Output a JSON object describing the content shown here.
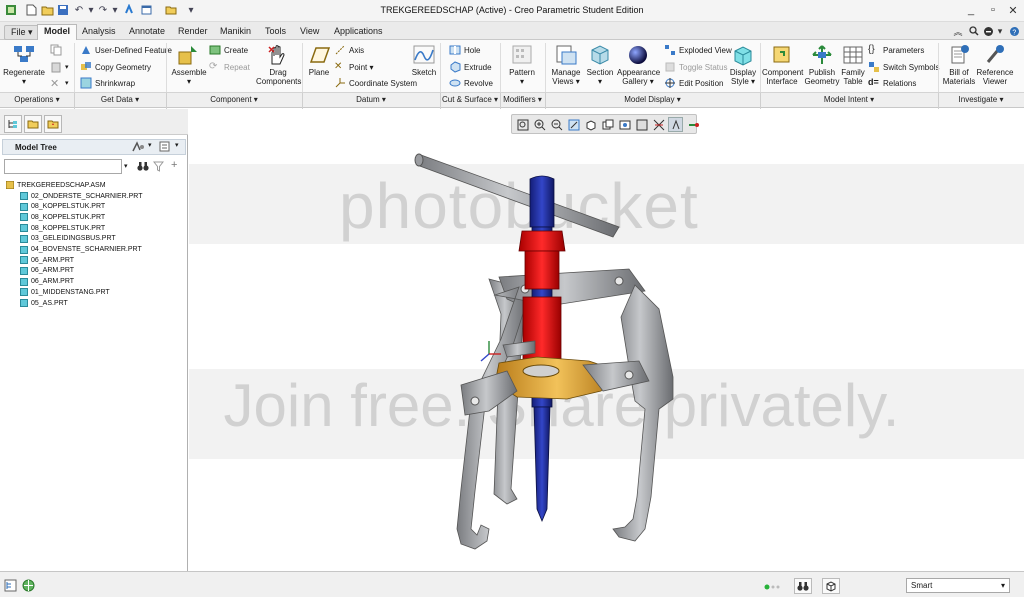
{
  "window": {
    "title": "TREKGEREEDSCHAP (Active) - Creo Parametric Student Edition"
  },
  "colors": {
    "accent": "#2f6fb8",
    "ribbon_bg": "#fafafa",
    "tree_part_icon": "#5fc8d9",
    "assembly_icon": "#e6c04a",
    "red_part": "#e01a1a",
    "blue_part": "#1f2fa8",
    "gold_part": "#e8a93a",
    "grey_part": "#a8aaae"
  },
  "menu": {
    "tabs": [
      "File",
      "Model",
      "Analysis",
      "Annotate",
      "Render",
      "Manikin",
      "Tools",
      "View",
      "Applications"
    ],
    "active": "Model"
  },
  "ribbon": {
    "regenerate": "Regenerate",
    "user_defined_feature": "User-Defined Feature",
    "copy_geometry": "Copy Geometry",
    "shrinkwrap": "Shrinkwrap",
    "assemble": "Assemble",
    "create": "Create",
    "repeat": "Repeat",
    "drag_components": "Drag Components",
    "plane": "Plane",
    "axis": "Axis",
    "point": "Point",
    "coordinate_system": "Coordinate System",
    "sketch": "Sketch",
    "hole": "Hole",
    "extrude": "Extrude",
    "revolve": "Revolve",
    "pattern": "Pattern",
    "manage_views": "Manage Views",
    "section": "Section",
    "appearance_gallery": "Appearance Gallery",
    "exploded_view": "Exploded View",
    "toggle_status": "Toggle Status",
    "edit_position": "Edit Position",
    "display_style": "Display Style",
    "component_interface": "Component Interface",
    "publish_geometry": "Publish Geometry",
    "family_table": "Family Table",
    "parameters": "Parameters",
    "switch_symbols": "Switch Symbols",
    "relations": "Relations",
    "bill_of_materials": "Bill of Materials",
    "reference_viewer": "Reference Viewer"
  },
  "groups": [
    "Operations",
    "Get Data",
    "Component",
    "Datum",
    "Cut & Surface",
    "Modifiers",
    "Model Display",
    "Model Intent",
    "Investigate"
  ],
  "model_tree": {
    "title": "Model Tree",
    "search_placeholder": "",
    "root": "TREKGEREEDSCHAP.ASM",
    "items": [
      "02_ONDERSTE_SCHARNIER.PRT",
      "08_KOPPELSTUK.PRT",
      "08_KOPPELSTUK.PRT",
      "08_KOPPELSTUK.PRT",
      "03_GELEIDINGSBUS.PRT",
      "04_BOVENSTE_SCHARNIER.PRT",
      "06_ARM.PRT",
      "06_ARM.PRT",
      "06_ARM.PRT",
      "01_MIDDENSTANG.PRT",
      "05_AS.PRT"
    ]
  },
  "watermark": {
    "brand": "photobucket",
    "slogan": "Join free. Share privately."
  },
  "statusbar": {
    "filter": "Smart"
  }
}
